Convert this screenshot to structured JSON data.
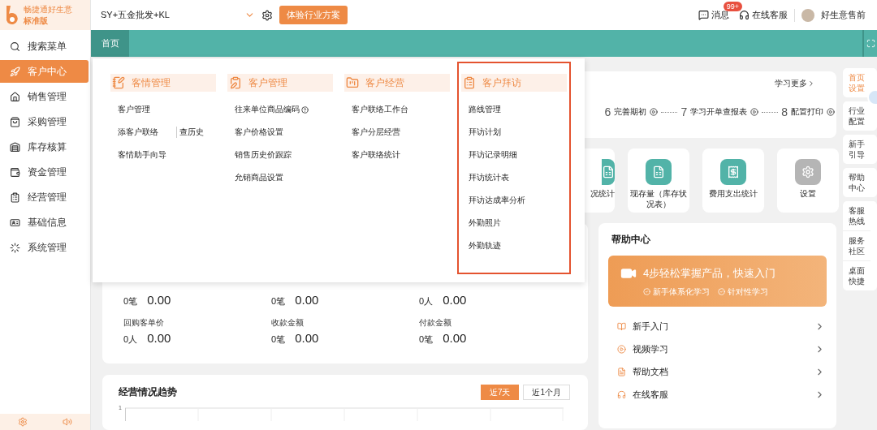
{
  "brand": {
    "name": "畅捷通好生意",
    "edition": "标准版"
  },
  "topbar": {
    "account": "SY+五金批发+KL",
    "trial_button": "体验行业方案",
    "messages": {
      "label": "消息",
      "badge": "99+"
    },
    "support": "在线客服",
    "user": "好生意售前"
  },
  "sidebar": {
    "items": [
      {
        "label": "搜索菜单",
        "selected": false
      },
      {
        "label": "客户中心",
        "selected": true
      },
      {
        "label": "销售管理",
        "selected": false
      },
      {
        "label": "采购管理",
        "selected": false
      },
      {
        "label": "库存核算",
        "selected": false
      },
      {
        "label": "资金管理",
        "selected": false
      },
      {
        "label": "经营管理",
        "selected": false
      },
      {
        "label": "基础信息",
        "selected": false
      },
      {
        "label": "系统管理",
        "selected": false
      }
    ]
  },
  "tabs": [
    {
      "label": "首页",
      "selected": true
    }
  ],
  "menu": {
    "columns": [
      {
        "title": "客情管理",
        "highlighted": false,
        "items": [
          {
            "label": "客户管理"
          },
          {
            "label": "添客户联络",
            "extra": "查历史"
          },
          {
            "label": "客情助手向导"
          }
        ]
      },
      {
        "title": "客户管理",
        "highlighted": false,
        "items": [
          {
            "label": "往来单位商品编码",
            "help": true
          },
          {
            "label": "客户价格设置"
          },
          {
            "label": "销售历史价跟踪"
          },
          {
            "label": "允销商品设置"
          }
        ]
      },
      {
        "title": "客户经营",
        "highlighted": false,
        "items": [
          {
            "label": "客户联络工作台"
          },
          {
            "label": "客户分层经营"
          },
          {
            "label": "客户联络统计"
          }
        ]
      },
      {
        "title": "客户拜访",
        "highlighted": true,
        "items": [
          {
            "label": "路线管理"
          },
          {
            "label": "拜访计划"
          },
          {
            "label": "拜访记录明细"
          },
          {
            "label": "拜访统计表"
          },
          {
            "label": "拜访达成率分析"
          },
          {
            "label": "外勤照片"
          },
          {
            "label": "外勤轨迹"
          }
        ]
      }
    ]
  },
  "guide": {
    "more_link": "学习更多",
    "steps": [
      {
        "number": "6",
        "label": "完善期初"
      },
      {
        "number": "7",
        "label": "学习开单查报表"
      },
      {
        "number": "8",
        "label": "配置打印"
      }
    ]
  },
  "tiles": [
    {
      "label": "况统计",
      "kind": "partial"
    },
    {
      "label": "现存量（库存状况表）",
      "kind": "teal"
    },
    {
      "label": "费用支出统计",
      "kind": "teal"
    },
    {
      "label": "设置",
      "kind": "gray"
    }
  ],
  "stats": {
    "rows": [
      [
        {
          "count": "0笔",
          "amount": "0.00"
        },
        {
          "count": "0笔",
          "amount": "0.00"
        },
        {
          "count": "0人",
          "amount": "0.00"
        }
      ],
      [
        {
          "label": "回购客单价",
          "count": "0人",
          "amount": "0.00"
        },
        {
          "label": "收款金额",
          "count": "0笔",
          "amount": "0.00"
        },
        {
          "label": "付款金额",
          "count": "0笔",
          "amount": "0.00"
        }
      ]
    ]
  },
  "trend": {
    "title": "经营情况趋势",
    "ranges": [
      {
        "label": "近7天",
        "selected": true
      },
      {
        "label": "近1个月",
        "selected": false
      }
    ],
    "y_tick": "1"
  },
  "help_center": {
    "title": "帮助中心",
    "banner": {
      "title": "4步轻松掌握产品，快速入门",
      "tags": [
        "新手体系化学习",
        "针对性学习"
      ]
    },
    "links": [
      {
        "label": "新手入门"
      },
      {
        "label": "视频学习"
      },
      {
        "label": "帮助文档"
      },
      {
        "label": "在线客服"
      }
    ]
  },
  "rail": [
    {
      "items": [
        {
          "label": "首页设置",
          "selected": true
        }
      ]
    },
    {
      "items": [
        {
          "label": "行业配置",
          "selected": false
        }
      ]
    },
    {
      "items": [
        {
          "label": "新手引导",
          "selected": false
        }
      ]
    },
    {
      "items": [
        {
          "label": "帮助中心",
          "selected": false
        }
      ]
    },
    {
      "items": [
        {
          "label": "客服热线",
          "selected": false
        },
        {
          "label": "服务社区",
          "selected": false
        },
        {
          "label": "桌面快捷",
          "selected": false
        }
      ]
    }
  ]
}
